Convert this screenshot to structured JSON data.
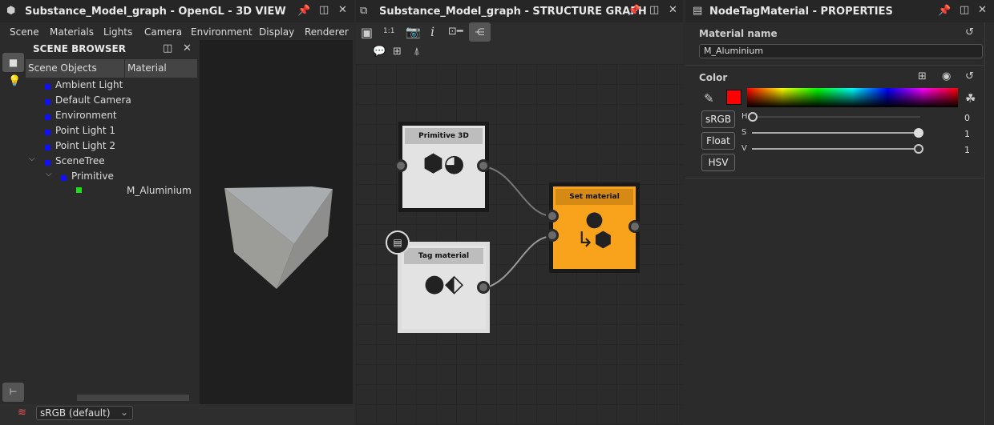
{
  "view3d": {
    "title": "Substance_Model_graph - OpenGL - 3D VIEW",
    "menu": [
      "Scene",
      "Materials",
      "Lights",
      "Camera",
      "Environment",
      "Display",
      "Renderer"
    ]
  },
  "scene_browser": {
    "title": "SCENE BROWSER",
    "columns": [
      "Scene Objects",
      "Material"
    ],
    "items": [
      "Ambient Light",
      "Default Camera",
      "Environment",
      "Point Light 1",
      "Point Light 2",
      "SceneTree",
      "Primitive"
    ],
    "material": "M_Aluminium"
  },
  "colorspace": {
    "selected": "sRGB (default)"
  },
  "graph": {
    "title": "Substance_Model_graph - STRUCTURE GRAPH",
    "zoom_label": "1:1",
    "nodes": {
      "primitive": "Primitive 3D",
      "tag": "Tag material",
      "set": "Set material"
    },
    "accent": "#f9a21b"
  },
  "properties": {
    "title": "NodeTagMaterial - PROPERTIES",
    "material_name_label": "Material name",
    "material_name": "M_Aluminium",
    "color_label": "Color",
    "swatch": "#ff0000",
    "buttons": [
      "sRGB",
      "Float",
      "HSV"
    ],
    "sliders": [
      {
        "label": "H",
        "value": "0",
        "fraction": 0
      },
      {
        "label": "S",
        "value": "1",
        "fraction": 1
      },
      {
        "label": "V",
        "value": "1",
        "fraction": 1
      }
    ]
  }
}
